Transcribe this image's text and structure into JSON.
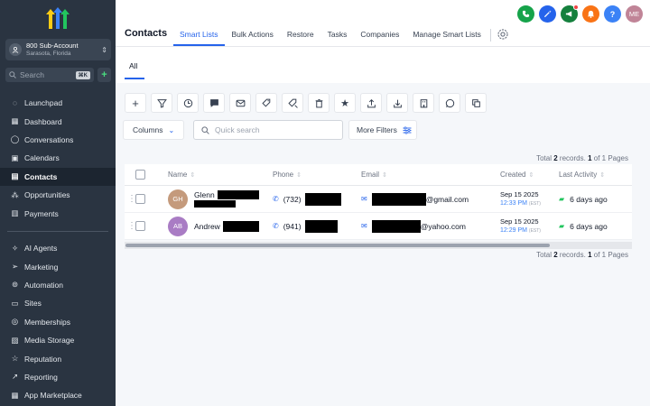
{
  "sidebar": {
    "account": {
      "name": "800 Sub-Account",
      "location": "Sarasota, Florida"
    },
    "search": {
      "placeholder": "Search",
      "shortcut": "⌘K"
    },
    "nav_top": [
      {
        "label": "Launchpad",
        "icon": "rocket-icon"
      },
      {
        "label": "Dashboard",
        "icon": "grid-icon"
      },
      {
        "label": "Conversations",
        "icon": "chat-icon"
      },
      {
        "label": "Calendars",
        "icon": "calendar-icon"
      },
      {
        "label": "Contacts",
        "icon": "contact-card-icon",
        "active": true
      },
      {
        "label": "Opportunities",
        "icon": "network-icon"
      },
      {
        "label": "Payments",
        "icon": "invoice-icon"
      }
    ],
    "nav_bottom": [
      {
        "label": "AI Agents",
        "icon": "sparkle-icon"
      },
      {
        "label": "Marketing",
        "icon": "send-icon"
      },
      {
        "label": "Automation",
        "icon": "automation-icon"
      },
      {
        "label": "Sites",
        "icon": "browser-icon"
      },
      {
        "label": "Memberships",
        "icon": "award-icon"
      },
      {
        "label": "Media Storage",
        "icon": "image-icon"
      },
      {
        "label": "Reputation",
        "icon": "star-icon"
      },
      {
        "label": "Reporting",
        "icon": "trend-icon"
      },
      {
        "label": "App Marketplace",
        "icon": "apps-icon"
      }
    ]
  },
  "header": {
    "title": "Contacts",
    "tabs": [
      "Smart Lists",
      "Bulk Actions",
      "Restore",
      "Tasks",
      "Companies",
      "Manage Smart Lists"
    ],
    "active_tab": "Smart Lists",
    "avatar_initials": "ME",
    "icon_colors": [
      "#16a34a",
      "#2563eb",
      "#15803d",
      "#f97316",
      "#3b82f6",
      "#c08497"
    ]
  },
  "subtabs": {
    "all": "All"
  },
  "filters": {
    "columns_label": "Columns",
    "quick_search_placeholder": "Quick search",
    "more_filters_label": "More Filters"
  },
  "totals": {
    "prefix": "Total",
    "count": "2",
    "middle": "records.",
    "page": "1",
    "suffix": "of 1 Pages"
  },
  "table": {
    "headers": {
      "name": "Name",
      "phone": "Phone",
      "email": "Email",
      "created": "Created",
      "last_activity": "Last Activity"
    },
    "rows": [
      {
        "initials": "GH",
        "avatar_color": "#c49a7c",
        "first_name": "Glenn",
        "phone_prefix": "(732)",
        "email_domain": "@gmail.com",
        "created_date": "Sep 15 2025",
        "created_time": "12:33 PM",
        "tz": "(EST)",
        "last_activity": "6 days ago"
      },
      {
        "initials": "AB",
        "avatar_color": "#a97cc4",
        "first_name": "Andrew",
        "phone_prefix": "(941)",
        "email_domain": "@yahoo.com",
        "created_date": "Sep 15 2025",
        "created_time": "12:29 PM",
        "tz": "(EST)",
        "last_activity": "6 days ago"
      }
    ]
  }
}
